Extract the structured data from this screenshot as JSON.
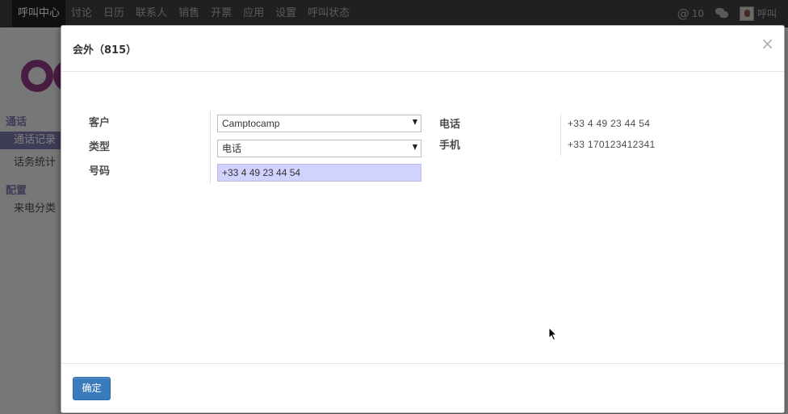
{
  "topbar": {
    "menu": [
      "呼叫中心",
      "讨论",
      "日历",
      "联系人",
      "销售",
      "开票",
      "应用",
      "设置",
      "呼叫状态"
    ],
    "mentions_count": "10",
    "user_name": "呼叫"
  },
  "sidebar": {
    "section_calls": "通话",
    "item_call_log": "通话记录",
    "item_call_stats": "话务统计",
    "section_config": "配置",
    "item_call_category": "来电分类"
  },
  "dialog": {
    "title": "会外（815）",
    "close": "×",
    "fields": {
      "customer_label": "客户",
      "customer_value": "Camptocamp",
      "type_label": "类型",
      "type_value": "电话",
      "number_label": "号码",
      "number_value": "+33 4 49 23 44 54",
      "phone_label": "电话",
      "phone_value": "+33 4 49 23 44 54",
      "mobile_label": "手机",
      "mobile_value": "+33 170123412341"
    },
    "ok_button": "确定"
  }
}
